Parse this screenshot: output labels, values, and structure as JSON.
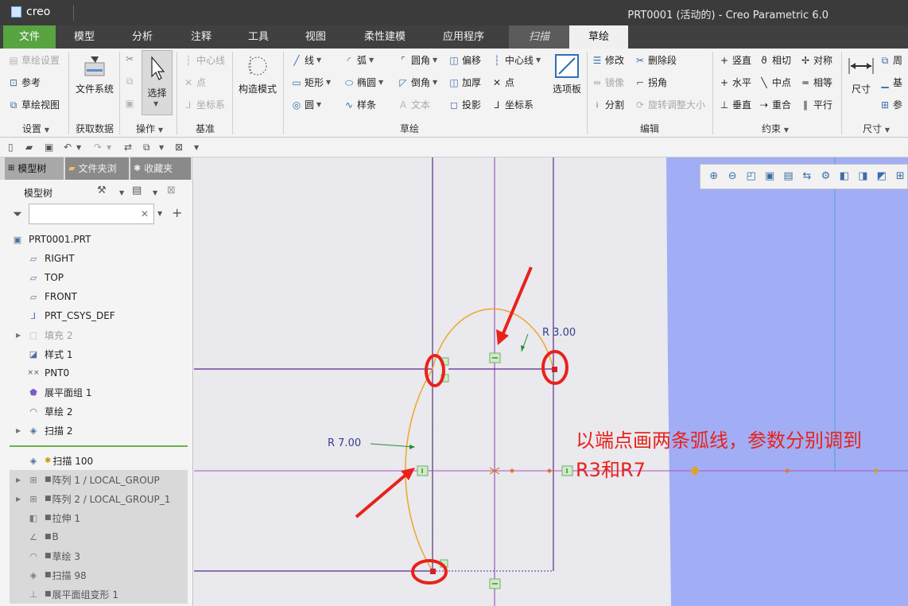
{
  "app": {
    "logo_text": "creo",
    "window_title": "PRT0001 (活动的) - Creo Parametric 6.0"
  },
  "tabs": [
    {
      "label": "文件"
    },
    {
      "label": "模型"
    },
    {
      "label": "分析"
    },
    {
      "label": "注释"
    },
    {
      "label": "工具"
    },
    {
      "label": "视图"
    },
    {
      "label": "柔性建模"
    },
    {
      "label": "应用程序"
    },
    {
      "label": "扫描"
    },
    {
      "label": "草绘"
    }
  ],
  "ribbon": {
    "setup": {
      "items": [
        "草绘设置",
        "参考",
        "草绘视图"
      ],
      "group": "设置"
    },
    "get_data": {
      "button": "文件系统",
      "group": "获取数据"
    },
    "operations": {
      "select": "选择",
      "group": "操作"
    },
    "datum": {
      "items": [
        "中心线",
        "点",
        "坐标系"
      ],
      "group": "基准"
    },
    "construction": {
      "button": "构造模式"
    },
    "sketching": {
      "items": [
        "线",
        "弧",
        "圆角",
        "偏移",
        "中心线",
        "矩形",
        "椭圆",
        "倒角",
        "加厚",
        "点",
        "圆",
        "样条",
        "文本",
        "投影",
        "坐标系"
      ],
      "palette": "选项板",
      "group": "草绘"
    },
    "editing": {
      "items": [
        "修改",
        "删除段",
        "镜像",
        "拐角",
        "分割",
        "旋转调整大小"
      ],
      "group": "编辑"
    },
    "constrain": {
      "items": [
        "竖直",
        "相切",
        "对称",
        "水平",
        "中点",
        "相等",
        "垂直",
        "重合",
        "平行"
      ],
      "group": "约束"
    },
    "dimension": {
      "button": "尺寸",
      "items": [
        "周",
        "基",
        "参"
      ],
      "group": "尺寸"
    }
  },
  "panel": {
    "tabs": [
      "模型树",
      "文件夹浏",
      "收藏夹"
    ],
    "tree_title": "模型树",
    "filter_placeholder": "",
    "tree": [
      {
        "label": "PRT0001.PRT",
        "icon": "part-icon"
      },
      {
        "label": "RIGHT",
        "icon": "plane-icon"
      },
      {
        "label": "TOP",
        "icon": "plane-icon"
      },
      {
        "label": "FRONT",
        "icon": "plane-icon"
      },
      {
        "label": "PRT_CSYS_DEF",
        "icon": "csys-icon"
      },
      {
        "label": "填充 2",
        "icon": "fill-icon"
      },
      {
        "label": "样式 1",
        "icon": "style-icon"
      },
      {
        "label": "PNT0",
        "icon": "point-icon"
      },
      {
        "label": "展平面组 1",
        "icon": "flatten-quilt-icon"
      },
      {
        "label": "草绘 2",
        "icon": "sketch-icon"
      },
      {
        "label": "扫描 2",
        "icon": "sweep-icon"
      },
      {
        "label": "扫描 100",
        "icon": "sweep-icon"
      },
      {
        "label": "阵列 1 / LOCAL_GROUP",
        "icon": "pattern-icon"
      },
      {
        "label": "阵列 2 / LOCAL_GROUP_1",
        "icon": "pattern-icon"
      },
      {
        "label": "拉伸 1",
        "icon": "extrude-icon"
      },
      {
        "label": "B",
        "icon": "curve-icon"
      },
      {
        "label": "草绘 3",
        "icon": "sketch-icon"
      },
      {
        "label": "扫描 98",
        "icon": "sweep-icon"
      },
      {
        "label": "展平面组变形 1",
        "icon": "flatten-deform-icon"
      }
    ]
  },
  "canvas": {
    "dim_r3": "R 3.00",
    "dim_r7": "R 7.00",
    "note_line1": "以端点画两条弧线，参数分别调到",
    "note_line2": "R3和R7",
    "colors": {
      "sketch": "#f0a52a",
      "reference": "#6a2a8a",
      "annotation": "#e8221b",
      "model_fill": "#a1aef5"
    }
  }
}
